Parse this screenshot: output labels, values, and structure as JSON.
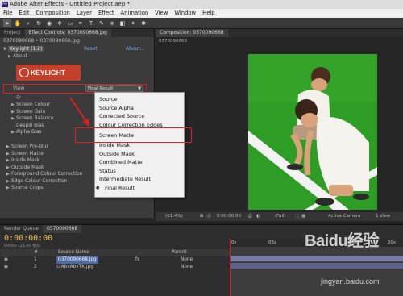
{
  "window": {
    "title": "Adobe After Effects - Untitled Project.aep *",
    "app_icon": "Ae"
  },
  "menu": [
    "File",
    "Edit",
    "Composition",
    "Layer",
    "Effect",
    "Animation",
    "View",
    "Window",
    "Help"
  ],
  "left_panel": {
    "tabs": [
      "Project",
      "Effect Controls: 0370090668.jpg"
    ],
    "breadcrumb": "0370090668 • 0370090668.jpg",
    "effect_name": "Keylight (1.2)",
    "reset": "Reset",
    "about": "About...",
    "about_group": "About",
    "logo_text": "KEYLIGHT",
    "view_label": "View",
    "view_value": "Final Result",
    "params": [
      "Screen Colour",
      "Screen Gain",
      "Screen Balance",
      "Despill Bias",
      "Alpha Bias"
    ],
    "groups": [
      "Screen Pre-blur",
      "Screen Matte",
      "Inside Mask",
      "Outside Mask",
      "Foreground Colour Correction",
      "Edge Colour Correction",
      "Source Crops"
    ]
  },
  "view_dropdown": {
    "options": [
      "Source",
      "Source Alpha",
      "Corrected Source",
      "Colour Correction Edges",
      "Screen Matte",
      "Inside Mask",
      "Outside Mask",
      "Combined Matte",
      "Status",
      "Intermediate Result",
      "Final Result"
    ],
    "selected": "Final Result",
    "highlighted": "Screen Matte"
  },
  "composition": {
    "tab": "Composition: 0370090668",
    "breadcrumb": "0370090668",
    "zoom": "(61.4%)",
    "timecode": "0:00:00:00",
    "resolution": "(Full)",
    "camera": "Active Camera",
    "views": "1 View"
  },
  "timeline": {
    "tabs": [
      "Render Queue",
      "0370090668"
    ],
    "timecode": "0:00:00:00",
    "fps": "00000 (25.00 fps)",
    "header": {
      "num": "#",
      "source": "Source Name",
      "parent": "Parent"
    },
    "layers": [
      {
        "num": "1",
        "name": "0370090668.jpg",
        "parent": "None"
      },
      {
        "num": "2",
        "name": "crAbvAbvTK.jpg",
        "parent": "None"
      }
    ],
    "ruler": [
      "0s",
      "05s",
      "10s",
      "15s",
      "20s"
    ]
  },
  "watermark": {
    "brand": "Baidu经验",
    "url": "jingyan.baidu.com"
  },
  "colors": {
    "accent_red": "#e02020",
    "timecode": "#e8c15a",
    "keylight": "#c5402a",
    "grass": "#2d9e24"
  }
}
